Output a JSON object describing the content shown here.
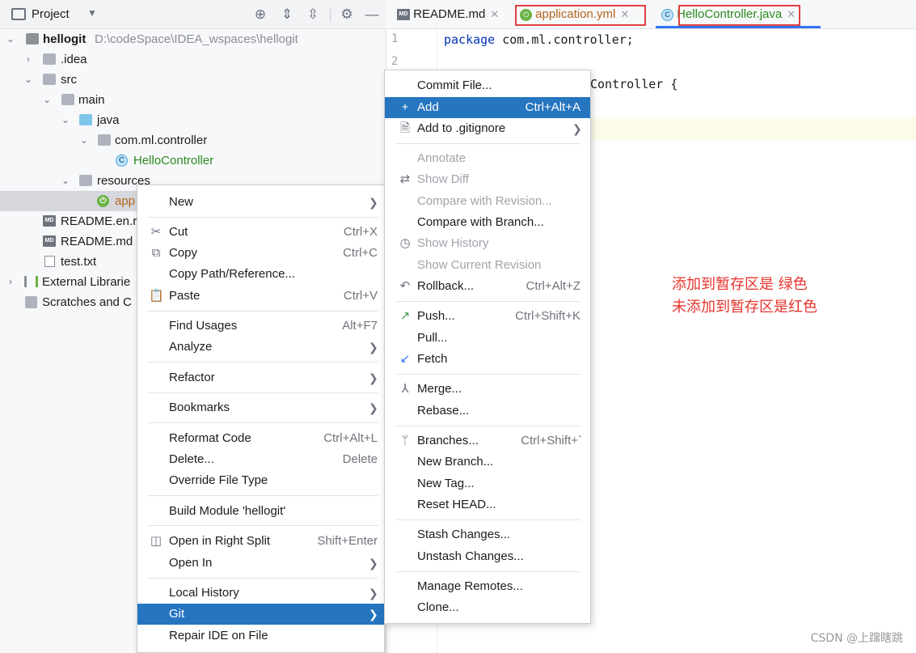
{
  "project_panel": {
    "title": "Project",
    "tree": [
      {
        "label": "hellogit",
        "path": "D:\\codeSpace\\IDEA_wspaces\\hellogit"
      },
      {
        "label": ".idea"
      },
      {
        "label": "src"
      },
      {
        "label": "main"
      },
      {
        "label": "java"
      },
      {
        "label": "com.ml.controller"
      },
      {
        "label": "HelloController"
      },
      {
        "label": "resources"
      },
      {
        "label": "app"
      },
      {
        "label": "README.en.r"
      },
      {
        "label": "README.md"
      },
      {
        "label": "test.txt"
      },
      {
        "label": "External Librarie"
      },
      {
        "label": "Scratches and C"
      }
    ]
  },
  "editor": {
    "tabs": [
      {
        "label": "README.md"
      },
      {
        "label": "application.yml"
      },
      {
        "label": "HelloController.java"
      }
    ],
    "line_numbers": [
      "1",
      "2"
    ],
    "code": {
      "line1_kw": "package",
      "line1_rest": " com.ml.controller;",
      "line3_rest": "Controller {"
    }
  },
  "context_menu": {
    "items": [
      {
        "label": "New"
      },
      {
        "label": "Cut",
        "shortcut": "Ctrl+X"
      },
      {
        "label": "Copy",
        "shortcut": "Ctrl+C"
      },
      {
        "label": "Copy Path/Reference..."
      },
      {
        "label": "Paste",
        "shortcut": "Ctrl+V"
      },
      {
        "label": "Find Usages",
        "shortcut": "Alt+F7"
      },
      {
        "label": "Analyze"
      },
      {
        "label": "Refactor"
      },
      {
        "label": "Bookmarks"
      },
      {
        "label": "Reformat Code",
        "shortcut": "Ctrl+Alt+L"
      },
      {
        "label": "Delete...",
        "shortcut": "Delete"
      },
      {
        "label": "Override File Type"
      },
      {
        "label": "Build Module 'hellogit'"
      },
      {
        "label": "Open in Right Split",
        "shortcut": "Shift+Enter"
      },
      {
        "label": "Open In"
      },
      {
        "label": "Local History"
      },
      {
        "label": "Git"
      },
      {
        "label": "Repair IDE on File"
      }
    ]
  },
  "git_submenu": {
    "items": [
      {
        "label": "Commit File..."
      },
      {
        "label": "Add",
        "shortcut": "Ctrl+Alt+A"
      },
      {
        "label": "Add to .gitignore"
      },
      {
        "label": "Annotate"
      },
      {
        "label": "Show Diff"
      },
      {
        "label": "Compare with Revision..."
      },
      {
        "label": "Compare with Branch..."
      },
      {
        "label": "Show History"
      },
      {
        "label": "Show Current Revision"
      },
      {
        "label": "Rollback...",
        "shortcut": "Ctrl+Alt+Z"
      },
      {
        "label": "Push...",
        "shortcut": "Ctrl+Shift+K"
      },
      {
        "label": "Pull..."
      },
      {
        "label": "Fetch"
      },
      {
        "label": "Merge..."
      },
      {
        "label": "Rebase..."
      },
      {
        "label": "Branches...",
        "shortcut": "Ctrl+Shift+`"
      },
      {
        "label": "New Branch..."
      },
      {
        "label": "New Tag..."
      },
      {
        "label": "Reset HEAD..."
      },
      {
        "label": "Stash Changes..."
      },
      {
        "label": "Unstash Changes..."
      },
      {
        "label": "Manage Remotes..."
      },
      {
        "label": "Clone..."
      }
    ]
  },
  "annotation": {
    "line1": "添加到暂存区是   绿色",
    "line2": "未添加到暂存区是红色"
  },
  "watermark": "CSDN @上蹿瞎跳",
  "colors": {
    "highlight": "#2675bf",
    "added_green": "#2a8a1e",
    "annotation_red": "#e8342d",
    "tab_box_red": "#e04141"
  }
}
